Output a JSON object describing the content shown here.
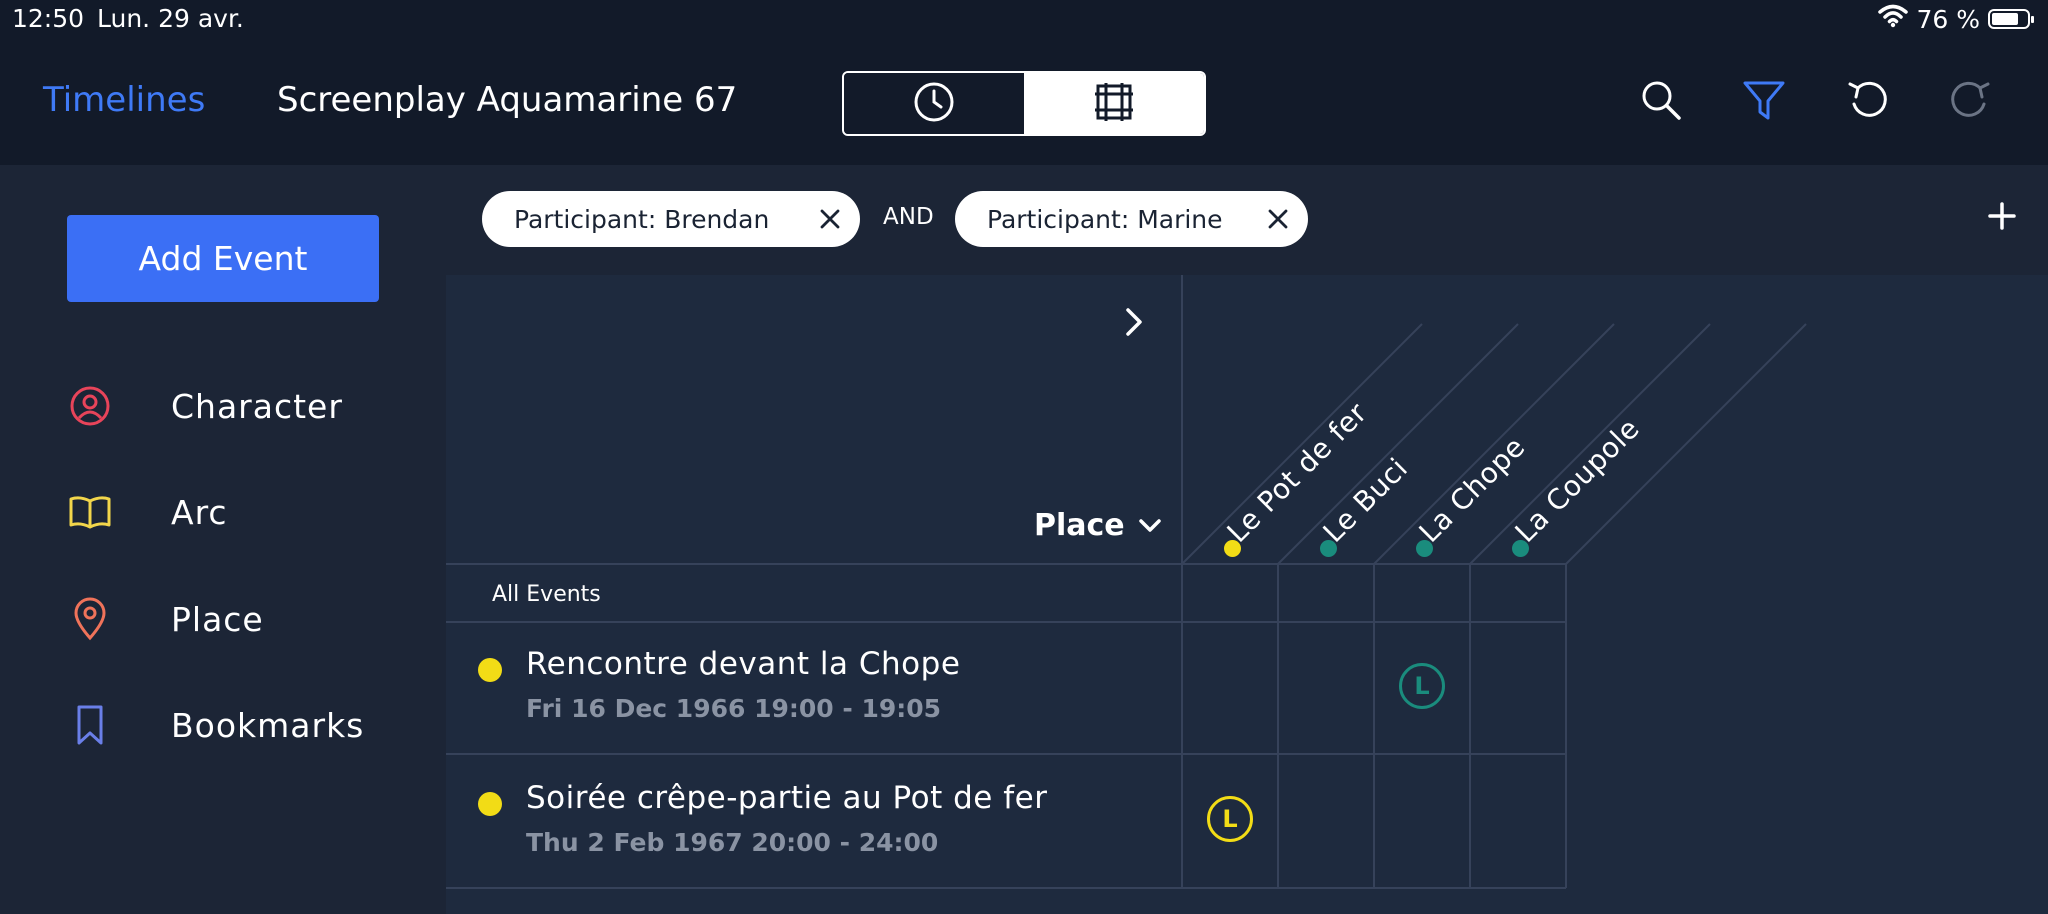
{
  "status": {
    "time": "12:50",
    "date": "Lun. 29 avr.",
    "battery": "76 %",
    "battery_level": 0.76
  },
  "header": {
    "back_label": "Timelines",
    "title": "Screenplay Aquamarine 67",
    "view_toggle": {
      "options": [
        "timeline-view",
        "grid-view"
      ],
      "selected": "grid-view"
    },
    "icons": [
      "search-icon",
      "filter-icon",
      "undo-icon",
      "redo-icon"
    ]
  },
  "sidebar": {
    "add_event_label": "Add Event",
    "items": [
      {
        "label": "Character",
        "icon": "person-circle-icon",
        "color": "#e8445a"
      },
      {
        "label": "Arc",
        "icon": "open-book-icon",
        "color": "#f2d64b"
      },
      {
        "label": "Place",
        "icon": "map-pin-icon",
        "color": "#f0735a"
      },
      {
        "label": "Bookmarks",
        "icon": "bookmark-icon",
        "color": "#6a7fe8"
      }
    ]
  },
  "filters": {
    "chips": [
      "Participant: Brendan",
      "Participant: Marine"
    ],
    "operator": "AND"
  },
  "grid": {
    "group_by": "Place",
    "all_events_label": "All Events",
    "columns": [
      {
        "name": "Le Pot de fer",
        "color": "#f2dc16"
      },
      {
        "name": "Le Buci",
        "color": "#1a8c7d"
      },
      {
        "name": "La Chope",
        "color": "#1a8c7d"
      },
      {
        "name": "La Coupole",
        "color": "#1a8c7d"
      }
    ],
    "rows": [
      {
        "title": "Rencontre devant la Chope",
        "time": "Fri 16 Dec 1966 19:00 - 19:05",
        "dot_color": "#f2dc16",
        "marker_column": 2,
        "marker_letter": "L",
        "marker_color": "#1a8c7d"
      },
      {
        "title": "Soirée crêpe-partie au Pot de fer",
        "time": "Thu 2 Feb 1967 20:00 - 24:00",
        "dot_color": "#f2dc16",
        "marker_column": 0,
        "marker_letter": "L",
        "marker_color": "#f2dc16"
      }
    ]
  },
  "colors": {
    "accent": "#3f7af6",
    "background": "#1a2333"
  }
}
